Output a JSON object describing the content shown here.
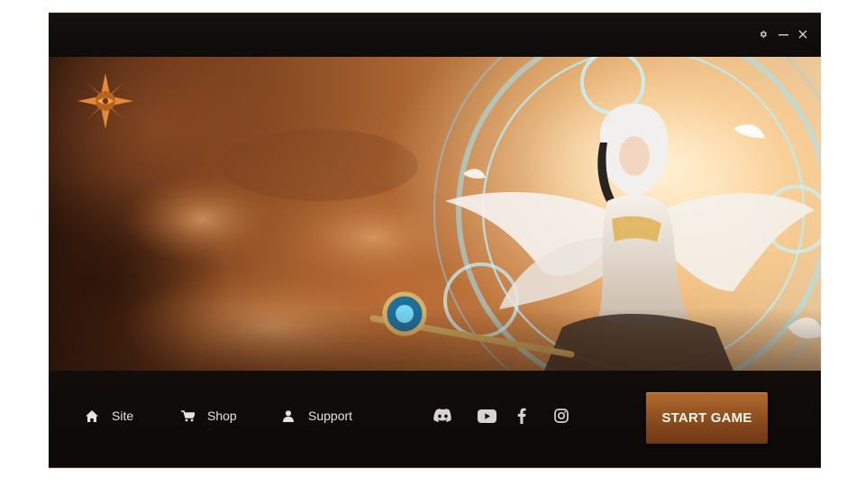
{
  "window": {
    "controls": [
      {
        "icon": "gear-icon"
      },
      {
        "icon": "minimize-icon"
      },
      {
        "icon": "close-icon"
      }
    ]
  },
  "banner": {
    "logo_icon": "compass-star-logo",
    "art": "angel-sorceress-with-staff-and-rune-circle"
  },
  "footer": {
    "nav": [
      {
        "label": "Site",
        "icon": "home-icon"
      },
      {
        "label": "Shop",
        "icon": "cart-icon"
      },
      {
        "label": "Support",
        "icon": "user-icon"
      }
    ],
    "social": [
      {
        "icon": "discord-icon"
      },
      {
        "icon": "youtube-icon"
      },
      {
        "icon": "facebook-icon"
      },
      {
        "icon": "instagram-icon"
      }
    ],
    "start_button": "START GAME"
  },
  "colors": {
    "accent": "#9a5522",
    "background": "#0f0b0a",
    "text": "#e9e3dd"
  }
}
